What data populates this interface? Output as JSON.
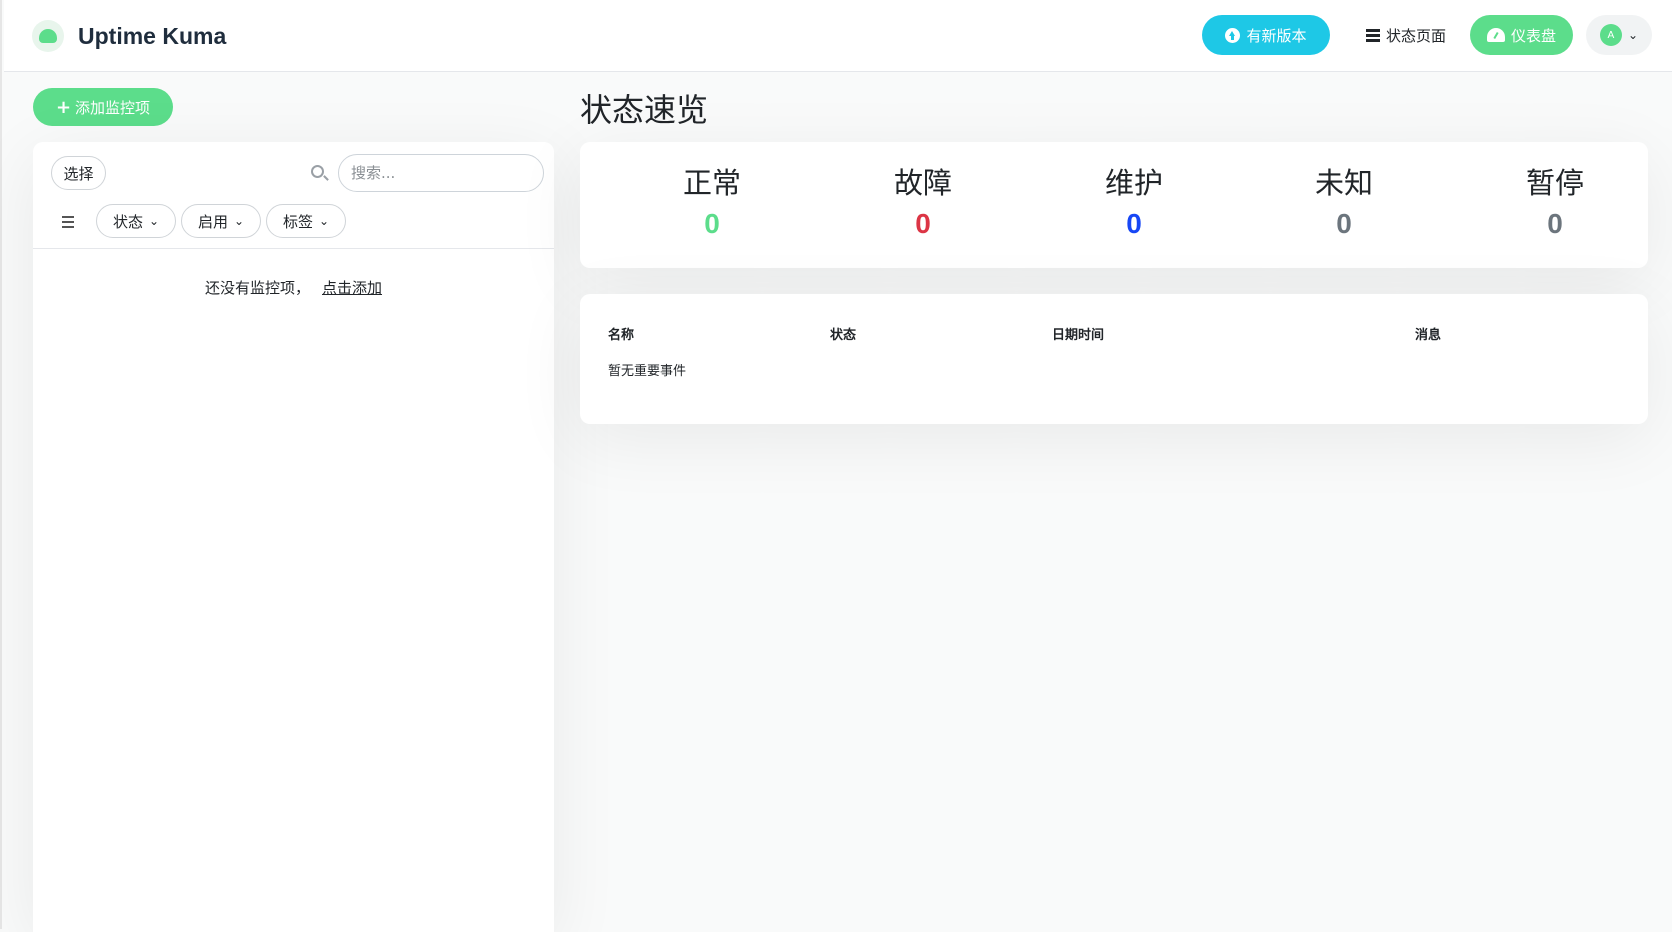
{
  "header": {
    "app_name": "Uptime Kuma",
    "update_label": "有新版本",
    "status_page_label": "状态页面",
    "dashboard_label": "仪表盘",
    "avatar_letter": "A"
  },
  "sidebar": {
    "add_monitor_label": "添加监控项",
    "select_label": "选择",
    "search_placeholder": "搜索...",
    "filters": {
      "status": "状态",
      "active": "启用",
      "tags": "标签"
    },
    "empty_text": "还没有监控项，",
    "empty_link": "点击添加"
  },
  "main": {
    "title": "状态速览",
    "stats": [
      {
        "label": "正常",
        "value": "0",
        "color": "#5cdd8b"
      },
      {
        "label": "故障",
        "value": "0",
        "color": "#dc3545"
      },
      {
        "label": "维护",
        "value": "0",
        "color": "#1747f5"
      },
      {
        "label": "未知",
        "value": "0",
        "color": "#6c757d"
      },
      {
        "label": "暂停",
        "value": "0",
        "color": "#6c757d"
      }
    ],
    "events": {
      "columns": [
        "名称",
        "状态",
        "日期时间",
        "消息"
      ],
      "empty_text": "暂无重要事件"
    }
  },
  "colors": {
    "accent_green": "#5cdd8b",
    "update_cyan": "#1ec8e6"
  }
}
